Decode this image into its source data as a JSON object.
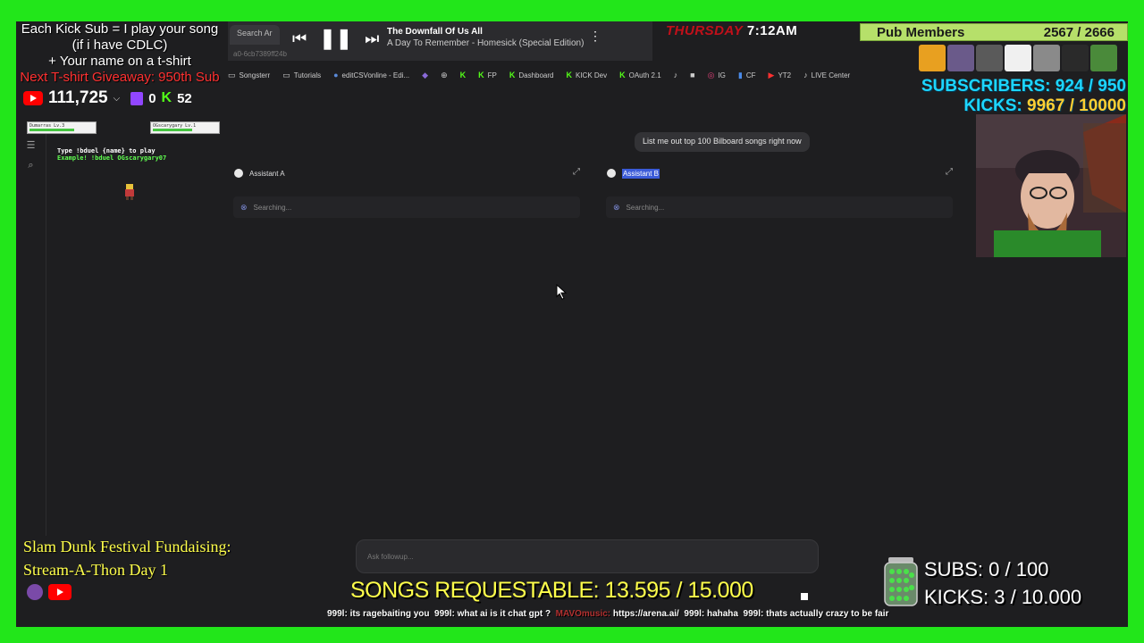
{
  "overlay": {
    "promo": {
      "line1": "Each Kick Sub = I play your song",
      "line2": "(if i have CDLC)",
      "line3": "+ Your name on a t-shirt",
      "line4": "Next T-shirt Giveaway: 950th Sub"
    },
    "stats": {
      "youtube_count": "111,725",
      "twitch_count": "0",
      "kick_count": "52"
    },
    "day": "THURSDAY",
    "time": "7:12AM",
    "pub_members_label": "Pub Members",
    "pub_members_value": "2567 / 2666",
    "subscribers_label": "SUBSCRIBERS:",
    "subscribers_value": "924 / 950",
    "kicks_label": "KICKS:",
    "kicks_value": "9967 / 10000",
    "duel_line1": "Type !bduel {name} to play",
    "duel_line2": "Example! !bduel OGscarygary07",
    "duel_player_a": "Dumarras  Lv.3",
    "duel_player_b": "OGscarygary  Lv.1",
    "fundraise_line1": "Slam Dunk Festival Fundaising:",
    "fundraise_line2": "Stream-A-Thon Day 1",
    "songs_requestable": "SONGS REQUESTABLE: 13.595 / 15.000",
    "subs_goal": "SUBS:  0 / 100",
    "kicks_goal": "KICKS: 3 / 10.000",
    "chat": [
      {
        "user": "999l:",
        "msg": "its ragebaiting you"
      },
      {
        "user": "999l:",
        "msg": "what ai is it chat gpt ?"
      },
      {
        "user": "MAVOmusic:",
        "msg": "https://arena.ai/"
      },
      {
        "user": "999l:",
        "msg": "hahaha"
      },
      {
        "user": "999l:",
        "msg": "thats actually crazy to be fair"
      }
    ]
  },
  "browser": {
    "tab_label": "Search Ar",
    "url_fragment": "a0-6cb7389ff24b",
    "media": {
      "song_title": "The Downfall Of Us All",
      "song_artist": "A Day To Remember - Homesick (Special Edition)"
    },
    "bookmarks": [
      {
        "label": "Songsterr",
        "icon": "folder"
      },
      {
        "label": "Tutorials",
        "icon": "folder"
      },
      {
        "label": "editCSVonline - Edi...",
        "icon": "csv"
      },
      {
        "label": "",
        "icon": "shield"
      },
      {
        "label": "",
        "icon": "globe"
      },
      {
        "label": "",
        "icon": "kick"
      },
      {
        "label": "FP",
        "icon": "kick"
      },
      {
        "label": "Dashboard",
        "icon": "kick"
      },
      {
        "label": "KICK Dev",
        "icon": "kick"
      },
      {
        "label": "OAuth 2.1",
        "icon": "kick"
      },
      {
        "label": "",
        "icon": "tiktok"
      },
      {
        "label": "",
        "icon": "pinterest"
      },
      {
        "label": "IG",
        "icon": "instagram"
      },
      {
        "label": "CF",
        "icon": "cf"
      },
      {
        "label": "YT2",
        "icon": "youtube"
      },
      {
        "label": "LIVE Center",
        "icon": "tiktok"
      }
    ]
  },
  "app": {
    "prompt": "List me out top 100 Bilboard songs right now",
    "assistant_a": "Assistant A",
    "assistant_b": "Assistant B",
    "searching": "Searching...",
    "followup_placeholder": "Ask followup..."
  },
  "colors": {
    "green_screen": "#22e61a",
    "kick_green": "#53fc18",
    "fundraise_yellow": "#ffff4a",
    "goal_blue": "#1dd6ff"
  }
}
